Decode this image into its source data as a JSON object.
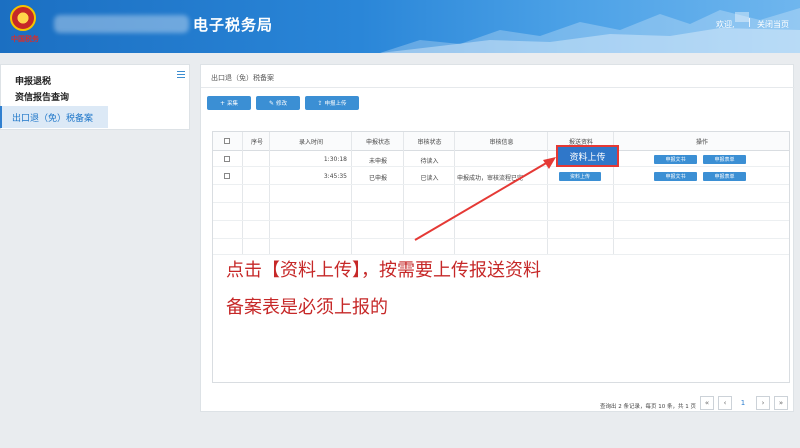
{
  "header": {
    "logo_text": "中国税务",
    "site_title": "电子税务局",
    "welcome": "欢迎,",
    "separator": "|",
    "close_page": "关闭当页"
  },
  "sidebar": {
    "group": "申报退税",
    "sub": "资信报告查询",
    "active_item": "出口退（免）税备案"
  },
  "main": {
    "breadcrumb": "出口退（免）税备案",
    "buttons": [
      {
        "icon": "+",
        "label": "采集"
      },
      {
        "icon": "✎",
        "label": "修改"
      },
      {
        "icon": "⇪",
        "label": "申报上传"
      }
    ],
    "table": {
      "headers": [
        "",
        "序号",
        "录入时间",
        "申报状态",
        "审核状态",
        "审核信息",
        "报送资料",
        "操作"
      ],
      "rows": [
        {
          "time": "1:30:18",
          "declare_status": "未申报",
          "audit_status": "待读入",
          "audit_info": "",
          "upload": "资料上传",
          "op1": "申报文书",
          "op2": "申报表单"
        },
        {
          "time": "3:45:35",
          "declare_status": "已申报",
          "audit_status": "已读入",
          "audit_info": "申报成功，审核流程已完",
          "upload": "资料上传",
          "op1": "申报文书",
          "op2": "申报表单"
        }
      ]
    },
    "pagination": {
      "info": "查询出 2 条记录，每页 10 条，共 1 页",
      "current_page": "1"
    }
  },
  "annotation": {
    "line1": "点击【资料上传】，按需要上传报送资料",
    "line2": "备案表是必须上报的"
  },
  "colors": {
    "header_blue": "#1b6fc2",
    "button_blue": "#3b8fd4",
    "annotation_red": "#c62828"
  }
}
